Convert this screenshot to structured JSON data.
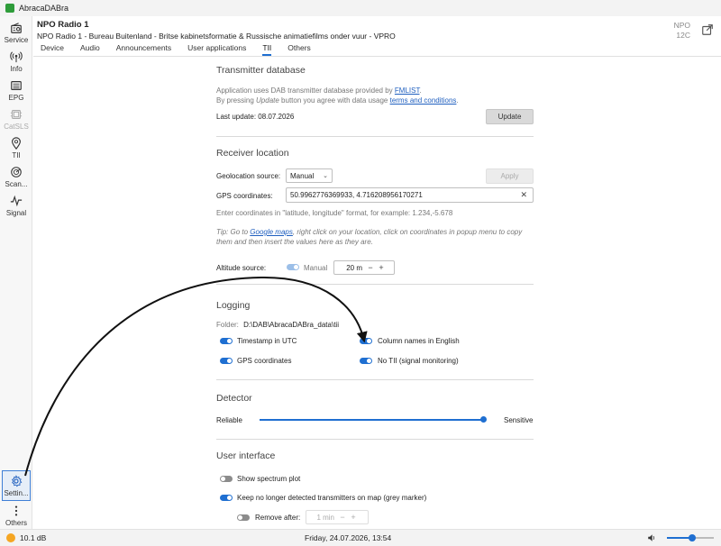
{
  "app": {
    "title": "AbracaDABra"
  },
  "sidebar": {
    "items": [
      {
        "label": "Service",
        "icon": "radio-icon"
      },
      {
        "label": "Info",
        "icon": "broadcast-icon"
      },
      {
        "label": "EPG",
        "icon": "epg-icon"
      },
      {
        "label": "CatSLS",
        "icon": "catsls-icon",
        "disabled": true
      },
      {
        "label": "TII",
        "icon": "location-pin-icon"
      },
      {
        "label": "Scan...",
        "icon": "scan-icon"
      },
      {
        "label": "Signal",
        "icon": "signal-icon"
      }
    ],
    "settings_label": "Settin...",
    "others_label": "Others"
  },
  "header": {
    "station_name": "NPO Radio 1",
    "station_text": "NPO Radio 1 - Bureau Buitenland - Britse kabinetsformatie & Russische animatiefilms onder vuur - VPRO",
    "ensemble": "NPO",
    "channel": "12C"
  },
  "tabs": [
    "Device",
    "Audio",
    "Announcements",
    "User applications",
    "TII",
    "Others"
  ],
  "active_tab": "TII",
  "transmitter_db": {
    "title": "Transmitter database",
    "info_prefix": "Application uses DAB transmitter database provided by ",
    "info_link": "FMLIST",
    "info_suffix": ".",
    "agree_prefix": "By pressing ",
    "agree_emph": "Update",
    "agree_mid": " button you agree with data usage ",
    "agree_link": "terms and conditions",
    "agree_suffix": ".",
    "last_update": "Last update: 08.07.2026",
    "update_button": "Update"
  },
  "receiver_location": {
    "title": "Receiver location",
    "geolocation_label": "Geolocation source:",
    "geolocation_value": "Manual",
    "apply_button": "Apply",
    "gps_label": "GPS coordinates:",
    "gps_value": "50.9962776369933, 4.716208956170271",
    "hint": "Enter coordinates in \"latitude, longitude\" format, for example: 1.234,-5.678",
    "tip_prefix": "Tip: Go to ",
    "tip_link": "Google maps",
    "tip_suffix": ", right click on your location, click on coordinates in popup menu to copy",
    "tip_line2": "them and then insert the values here as they are.",
    "altitude_label": "Altitude source:",
    "altitude_toggle_label": "Manual",
    "altitude_value": "20 m"
  },
  "logging": {
    "title": "Logging",
    "folder_label": "Folder:",
    "folder_value": "D:\\DAB\\AbracaDABra_data\\tii",
    "options": {
      "timestamp_utc": "Timestamp in UTC",
      "column_names": "Column names in English",
      "gps_coords": "GPS coordinates",
      "no_tii": "No TII (signal monitoring)"
    }
  },
  "detector": {
    "title": "Detector",
    "left_label": "Reliable",
    "right_label": "Sensitive",
    "level": 1.0
  },
  "user_interface": {
    "title": "User interface",
    "show_spectrum": "Show spectrum plot",
    "keep_transmitters": "Keep no longer detected transmitters on map (grey marker)",
    "remove_after": "Remove after:",
    "remove_after_value": "1 min"
  },
  "statusbar": {
    "snr": "10.1 dB",
    "datetime": "Friday, 24.07.2026, 13:54",
    "volume": 0.55
  },
  "colors": {
    "accent": "#1f6fd1",
    "signal_indicator": "#f5a623",
    "app_logo": "#2e9c3a"
  }
}
